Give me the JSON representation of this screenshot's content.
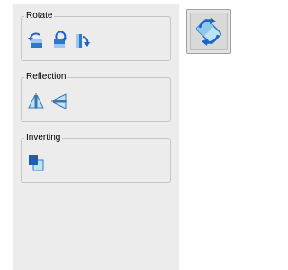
{
  "groups": {
    "rotate": {
      "title": "Rotate"
    },
    "reflection": {
      "title": "Reflection"
    },
    "inverting": {
      "title": "Inverting"
    }
  },
  "icons": {
    "rotate_left": "rotate-left-icon",
    "rotate_180": "rotate-180-icon",
    "rotate_right": "rotate-right-icon",
    "flip_vertical": "flip-vertical-icon",
    "flip_horizontal": "flip-horizontal-icon",
    "invert": "invert-icon",
    "rotate_tool": "rotate-tool-icon"
  },
  "colors": {
    "accent_blue": "#2f78c8",
    "light_blue": "#bfe3f6",
    "arrow_blue": "#1a63c9"
  }
}
